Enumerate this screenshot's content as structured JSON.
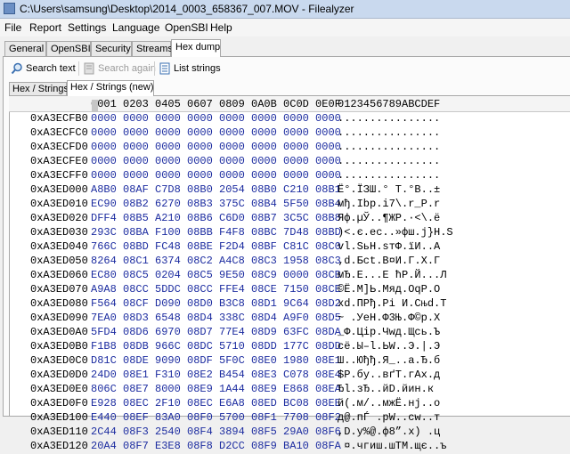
{
  "window": {
    "title": "C:\\Users\\samsung\\Desktop\\2014_0003_658367_007.MOV - Filealyzer"
  },
  "menu": [
    "File",
    "Report",
    "Settings",
    "Language",
    "OpenSBI",
    "Help"
  ],
  "tabs": [
    "General",
    "OpenSBI",
    "Security",
    "Streams",
    "Hex dump"
  ],
  "toolbar": {
    "search": "Search text",
    "search_again": "Search again",
    "list_strings": "List strings"
  },
  "subtabs": [
    "Hex / Strings",
    "Hex / Strings (new)"
  ],
  "hex_header": {
    "offsets": "0001 0203 0405 0607 0809 0A0B 0C0D 0E0F",
    "ascii": "0123456789ABCDEF"
  },
  "rows": [
    {
      "addr": "0xA3ECFB0",
      "hex": "0000 0000 0000 0000 0000 0000 0000 0000",
      "ascii": "................"
    },
    {
      "addr": "0xA3ECFC0",
      "hex": "0000 0000 0000 0000 0000 0000 0000 0000",
      "ascii": "................"
    },
    {
      "addr": "0xA3ECFD0",
      "hex": "0000 0000 0000 0000 0000 0000 0000 0000",
      "ascii": "................"
    },
    {
      "addr": "0xA3ECFE0",
      "hex": "0000 0000 0000 0000 0000 0000 0000 0000",
      "ascii": "................"
    },
    {
      "addr": "0xA3ECFF0",
      "hex": "0000 0000 0000 0000 0000 0000 0000 0000",
      "ascii": "................"
    },
    {
      "addr": "0xA3ED000",
      "hex": "A8B0 08AF C7D8 08B0 2054 08B0 C210 08B1",
      "ascii": "Ё°.ЇЗШ.° T.°В..±"
    },
    {
      "addr": "0xA3ED010",
      "hex": "EC90 08B2 6270 08B3 375C 08B4 5F50 08B4",
      "ascii": "мђ.Ibp.i7\\.r_P.r"
    },
    {
      "addr": "0xA3ED020",
      "hex": "DFF4 08B5 A210 08B6 C6D0 08B7 3C5C 08B8",
      "ascii": "Яф.µЎ..¶ЖР.·<\\.ё"
    },
    {
      "addr": "0xA3ED030",
      "hex": "293C 08BA F100 08BB F4F8 08BC 7D48 08BD",
      "ascii": ")<.є.ес..»фш.ј}Н.S"
    },
    {
      "addr": "0xA3ED040",
      "hex": "766C 08BD FC48 08BE F2D4 08BF C81C 08C0",
      "ascii": "vl.SьН.ѕтФ.їИ..А"
    },
    {
      "addr": "0xA3ED050",
      "hex": "8264 08C1 6374 08C2 A4C8 08C3 1958 08C3",
      "ascii": "‚d.Бct.В¤И.Г.X.Г"
    },
    {
      "addr": "0xA3ED060",
      "hex": "EC80 08C5 0204 08C5 9E50 08C9 0000 08CB",
      "ascii": "мЂ.Е...Е ћР.Й...Л"
    },
    {
      "addr": "0xA3ED070",
      "hex": "A9A8 08CC 5DDC 08CC FFE4 08CE 7150 08CE",
      "ascii": "©Ё.М]Ь.Мяд.ОqР.О"
    },
    {
      "addr": "0xA3ED080",
      "hex": "F564 08CF D090 08D0 B3C8 08D1 9C64 08D2",
      "ascii": "хd.ПРђ.Рі И.Сњd.Т"
    },
    {
      "addr": "0xA3ED090",
      "hex": "7EA0 08D3 6548 08D4 338C 08D4 A9F0 08D5",
      "ascii": "~ .УеН.Ф3Њ.Ф©р.Х"
    },
    {
      "addr": "0xA3ED0A0",
      "hex": "5FD4 08D6 6970 08D7 77E4 08D9 63FC 08DA",
      "ascii": "_Ф.Цip.Чwд.Щсь.Ъ"
    },
    {
      "addr": "0xA3ED0B0",
      "hex": "F1B8 08DB 966C 08DC 5710 08DD 177C 08DD",
      "ascii": "cё.Ы–l.ЬW..Э.|.Э"
    },
    {
      "addr": "0xA3ED0C0",
      "hex": "D81C 08DE 9090 08DF 5F0C 08E0 1980 08E1",
      "ascii": "Ш..Юђђ.Я_..а.Ђ.б"
    },
    {
      "addr": "0xA3ED0D0",
      "hex": "24D0 08E1 F310 08E2 B454 08E3 C078 08E4",
      "ascii": "$Р.бу..вґТ.гАх.д"
    },
    {
      "addr": "0xA3ED0E0",
      "hex": "806C 08E7 8000 08E9 1A44 08E9 E868 08EA",
      "ascii": "Ђl.зЂ..йD.йин.к"
    },
    {
      "addr": "0xA3ED0F0",
      "hex": "E928 08EC 2F10 08EC E6A8 08ED BC08 08EE",
      "ascii": "й(.м/..мжЁ.нј..о"
    },
    {
      "addr": "0xA3ED100",
      "hex": "E440 08EF 83A0 08F0 5700 08F1 7708 08F2",
      "ascii": "д@.пЃ .рW..сw..т"
    },
    {
      "addr": "0xA3ED110",
      "hex": "2C44 08F3 2540 08F4 3894 08F5 29A0 08F6",
      "ascii": ",D.у%@.ф8”.х) .ц"
    },
    {
      "addr": "0xA3ED120",
      "hex": "20A4 08F7 E3E8 08F8 D2CC 08F9 BA10 08FA",
      "ascii": " ¤.чгиш.шТМ.щє..ъ"
    }
  ]
}
